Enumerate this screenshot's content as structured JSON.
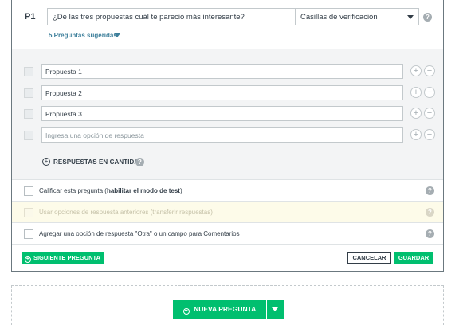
{
  "question": {
    "number": "P1",
    "text": "¿De las tres propuestas cuál te pareció más interesante?",
    "type": "Casillas de verificación",
    "suggested_link": "5 Preguntas sugeridas"
  },
  "answers": [
    {
      "value": "Propuesta 1",
      "placeholder": ""
    },
    {
      "value": "Propuesta 2",
      "placeholder": ""
    },
    {
      "value": "Propuesta 3",
      "placeholder": ""
    },
    {
      "value": "",
      "placeholder": "Ingresa una opción de respuesta"
    }
  ],
  "bulk_answers_label": "RESPUESTAS EN CANTIDAD",
  "options": {
    "score": {
      "text": "Calificar esta pregunta (",
      "bold": "habilitar el modo de test",
      "end": ")"
    },
    "prior": {
      "text": "Usar opciones de respuesta anteriores (transferir respuestas)"
    },
    "other": {
      "text": "Agregar una opción de respuesta \"Otra\" o un campo para Comentarios"
    }
  },
  "footer": {
    "next_label": "SIGUIENTE PREGUNTA",
    "cancel_label": "CANCELAR",
    "save_label": "GUARDAR"
  },
  "new_question_label": "NUEVA PREGUNTA",
  "colors": {
    "accent": "#00bf6f",
    "link": "#3d7f9b"
  }
}
